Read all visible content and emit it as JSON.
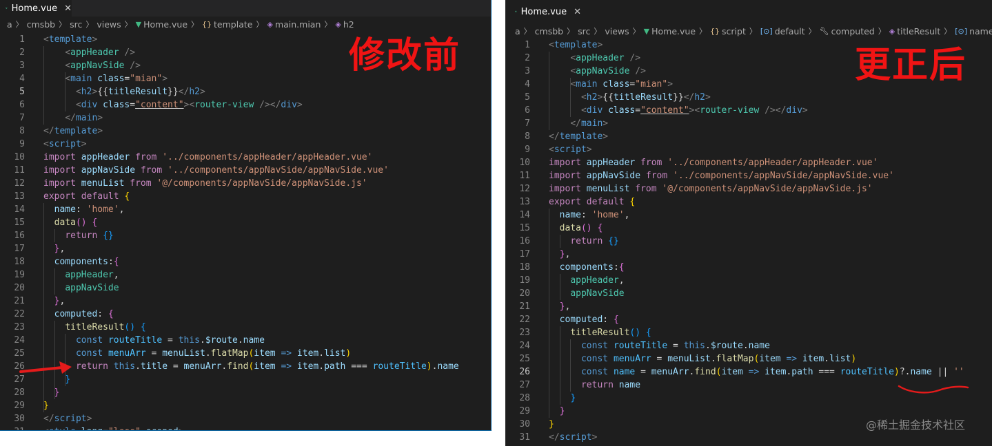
{
  "colors": {
    "editor_bg": "#1e1e1e",
    "annotation_red": "#f01414",
    "vue_green": "#41b883"
  },
  "left_editor": {
    "tab": {
      "label": "Home.vue",
      "icon": "vue-icon",
      "close": "✕"
    },
    "breadcrumb": [
      "a",
      "cmsbb",
      "src",
      "views",
      "Home.vue",
      "template",
      "main.mian",
      "h2"
    ],
    "annotation": "修改前"
  },
  "right_editor": {
    "tab": {
      "label": "Home.vue",
      "icon": "vue-icon",
      "close": "✕"
    },
    "breadcrumb": [
      "a",
      "cmsbb",
      "src",
      "views",
      "Home.vue",
      "script",
      "default",
      "computed",
      "titleResult",
      "name"
    ],
    "annotation": "更正后"
  },
  "watermark": "@稀土掘金技术社区",
  "code_before": [
    [
      [
        "t-br",
        "<"
      ],
      [
        "t-tag",
        "template"
      ],
      [
        "t-br",
        ">"
      ]
    ],
    [
      [
        "t-plain",
        "    "
      ],
      [
        "t-br",
        "<"
      ],
      [
        "t-cmp",
        "appHeader"
      ],
      [
        "t-plain",
        " "
      ],
      [
        "t-br",
        "/>"
      ]
    ],
    [
      [
        "t-plain",
        "    "
      ],
      [
        "t-br",
        "<"
      ],
      [
        "t-cmp",
        "appNavSide"
      ],
      [
        "t-plain",
        " "
      ],
      [
        "t-br",
        "/>"
      ]
    ],
    [
      [
        "t-plain",
        "    "
      ],
      [
        "t-br",
        "<"
      ],
      [
        "t-tag",
        "main"
      ],
      [
        "t-plain",
        " "
      ],
      [
        "t-attr",
        "class"
      ],
      [
        "t-plain",
        "="
      ],
      [
        "t-str",
        "\"mian\""
      ],
      [
        "t-br",
        ">"
      ]
    ],
    [
      [
        "t-plain",
        "      "
      ],
      [
        "t-br",
        "<"
      ],
      [
        "t-tag",
        "h2"
      ],
      [
        "t-br",
        ">"
      ],
      [
        "t-plain",
        "{{"
      ],
      [
        "t-var",
        "titleResult"
      ],
      [
        "t-plain",
        "}}"
      ],
      [
        "t-br",
        "</"
      ],
      [
        "t-tag",
        "h2"
      ],
      [
        "t-br",
        ">"
      ]
    ],
    [
      [
        "t-plain",
        "      "
      ],
      [
        "t-br",
        "<"
      ],
      [
        "t-tag",
        "div"
      ],
      [
        "t-plain",
        " "
      ],
      [
        "t-attr",
        "class"
      ],
      [
        "t-plain",
        "="
      ],
      [
        "t-str t-ul",
        "\"content\""
      ],
      [
        "t-br",
        ">"
      ],
      [
        "t-br",
        "<"
      ],
      [
        "t-cmp",
        "router-view"
      ],
      [
        "t-plain",
        " "
      ],
      [
        "t-br",
        "/>"
      ],
      [
        "t-br",
        "</"
      ],
      [
        "t-tag",
        "div"
      ],
      [
        "t-br",
        ">"
      ]
    ],
    [
      [
        "t-plain",
        "    "
      ],
      [
        "t-br",
        "</"
      ],
      [
        "t-tag",
        "main"
      ],
      [
        "t-br",
        ">"
      ]
    ],
    [
      [
        "t-br",
        "</"
      ],
      [
        "t-tag",
        "template"
      ],
      [
        "t-br",
        ">"
      ]
    ],
    [
      [
        "t-br",
        "<"
      ],
      [
        "t-tag",
        "script"
      ],
      [
        "t-br",
        ">"
      ]
    ],
    [
      [
        "t-kw",
        "import"
      ],
      [
        "t-plain",
        " "
      ],
      [
        "t-var",
        "appHeader"
      ],
      [
        "t-plain",
        " "
      ],
      [
        "t-kw",
        "from"
      ],
      [
        "t-plain",
        " "
      ],
      [
        "t-str",
        "'../components/appHeader/appHeader.vue'"
      ]
    ],
    [
      [
        "t-kw",
        "import"
      ],
      [
        "t-plain",
        " "
      ],
      [
        "t-var",
        "appNavSide"
      ],
      [
        "t-plain",
        " "
      ],
      [
        "t-kw",
        "from"
      ],
      [
        "t-plain",
        " "
      ],
      [
        "t-str",
        "'../components/appNavSide/appNavSide.vue'"
      ]
    ],
    [
      [
        "t-kw",
        "import"
      ],
      [
        "t-plain",
        " "
      ],
      [
        "t-var",
        "menuList"
      ],
      [
        "t-plain",
        " "
      ],
      [
        "t-kw",
        "from"
      ],
      [
        "t-plain",
        " "
      ],
      [
        "t-str",
        "'@/components/appNavSide/appNavSide.js'"
      ]
    ],
    [
      [
        "t-kw",
        "export"
      ],
      [
        "t-plain",
        " "
      ],
      [
        "t-kw",
        "default"
      ],
      [
        "t-plain",
        " "
      ],
      [
        "t-yel",
        "{"
      ]
    ],
    [
      [
        "t-plain",
        "  "
      ],
      [
        "t-var",
        "name"
      ],
      [
        "t-plain",
        ": "
      ],
      [
        "t-str",
        "'home'"
      ],
      [
        "t-plain",
        ","
      ]
    ],
    [
      [
        "t-plain",
        "  "
      ],
      [
        "t-fn",
        "data"
      ],
      [
        "t-pur",
        "()"
      ],
      [
        "t-plain",
        " "
      ],
      [
        "t-pur",
        "{"
      ]
    ],
    [
      [
        "t-plain",
        "    "
      ],
      [
        "t-kw",
        "return"
      ],
      [
        "t-plain",
        " "
      ],
      [
        "t-sky",
        "{}"
      ]
    ],
    [
      [
        "t-plain",
        "  "
      ],
      [
        "t-pur",
        "}"
      ],
      [
        "t-plain",
        ","
      ]
    ],
    [
      [
        "t-plain",
        "  "
      ],
      [
        "t-var",
        "components"
      ],
      [
        "t-plain",
        ":"
      ],
      [
        "t-pur",
        "{"
      ]
    ],
    [
      [
        "t-plain",
        "    "
      ],
      [
        "t-cmp",
        "appHeader"
      ],
      [
        "t-plain",
        ","
      ]
    ],
    [
      [
        "t-plain",
        "    "
      ],
      [
        "t-cmp",
        "appNavSide"
      ]
    ],
    [
      [
        "t-plain",
        "  "
      ],
      [
        "t-pur",
        "}"
      ],
      [
        "t-plain",
        ","
      ]
    ],
    [
      [
        "t-plain",
        "  "
      ],
      [
        "t-var",
        "computed"
      ],
      [
        "t-plain",
        ": "
      ],
      [
        "t-pur",
        "{"
      ]
    ],
    [
      [
        "t-plain",
        "    "
      ],
      [
        "t-fn",
        "titleResult"
      ],
      [
        "t-sky",
        "()"
      ],
      [
        "t-plain",
        " "
      ],
      [
        "t-sky",
        "{"
      ]
    ],
    [
      [
        "t-plain",
        "      "
      ],
      [
        "t-bl",
        "const"
      ],
      [
        "t-plain",
        " "
      ],
      [
        "t-cst",
        "routeTitle"
      ],
      [
        "t-plain",
        " = "
      ],
      [
        "t-bl",
        "this"
      ],
      [
        "t-plain",
        "."
      ],
      [
        "t-var",
        "$route"
      ],
      [
        "t-plain",
        "."
      ],
      [
        "t-var",
        "name"
      ]
    ],
    [
      [
        "t-plain",
        "      "
      ],
      [
        "t-bl",
        "const"
      ],
      [
        "t-plain",
        " "
      ],
      [
        "t-cst",
        "menuArr"
      ],
      [
        "t-plain",
        " = "
      ],
      [
        "t-var",
        "menuList"
      ],
      [
        "t-plain",
        "."
      ],
      [
        "t-fn",
        "flatMap"
      ],
      [
        "t-yel",
        "("
      ],
      [
        "t-var",
        "item"
      ],
      [
        "t-plain",
        " "
      ],
      [
        "t-bl",
        "=>"
      ],
      [
        "t-plain",
        " "
      ],
      [
        "t-var",
        "item"
      ],
      [
        "t-plain",
        "."
      ],
      [
        "t-var",
        "list"
      ],
      [
        "t-yel",
        ")"
      ]
    ],
    [
      [
        "t-plain",
        "      "
      ],
      [
        "t-kw",
        "return"
      ],
      [
        "t-plain",
        " "
      ],
      [
        "t-bl",
        "this"
      ],
      [
        "t-plain",
        "."
      ],
      [
        "t-var",
        "title"
      ],
      [
        "t-plain",
        " = "
      ],
      [
        "t-var",
        "menuArr"
      ],
      [
        "t-plain",
        "."
      ],
      [
        "t-fn",
        "find"
      ],
      [
        "t-yel",
        "("
      ],
      [
        "t-var",
        "item"
      ],
      [
        "t-plain",
        " "
      ],
      [
        "t-bl",
        "=>"
      ],
      [
        "t-plain",
        " "
      ],
      [
        "t-var",
        "item"
      ],
      [
        "t-plain",
        "."
      ],
      [
        "t-var",
        "path"
      ],
      [
        "t-plain",
        " === "
      ],
      [
        "t-cst",
        "routeTitle"
      ],
      [
        "t-yel",
        ")"
      ],
      [
        "t-plain",
        "."
      ],
      [
        "t-var",
        "name"
      ]
    ],
    [
      [
        "t-plain",
        "    "
      ],
      [
        "t-sky",
        "}"
      ]
    ],
    [
      [
        "t-plain",
        "  "
      ],
      [
        "t-pur",
        "}"
      ]
    ],
    [
      [
        "t-yel",
        "}"
      ]
    ],
    [
      [
        "t-br",
        "</"
      ],
      [
        "t-tag",
        "script"
      ],
      [
        "t-br",
        ">"
      ]
    ],
    [
      [
        "t-br",
        "<"
      ],
      [
        "t-tag",
        "style"
      ],
      [
        "t-plain",
        " "
      ],
      [
        "t-attr",
        "lang"
      ],
      [
        "t-plain",
        "="
      ],
      [
        "t-str",
        "\"less\""
      ],
      [
        "t-plain",
        " "
      ],
      [
        "t-attr",
        "scoped"
      ],
      [
        "t-br",
        ">"
      ]
    ]
  ],
  "code_after": [
    [
      [
        "t-br",
        "<"
      ],
      [
        "t-tag",
        "template"
      ],
      [
        "t-br",
        ">"
      ]
    ],
    [
      [
        "t-plain",
        "    "
      ],
      [
        "t-br",
        "<"
      ],
      [
        "t-cmp",
        "appHeader"
      ],
      [
        "t-plain",
        " "
      ],
      [
        "t-br",
        "/>"
      ]
    ],
    [
      [
        "t-plain",
        "    "
      ],
      [
        "t-br",
        "<"
      ],
      [
        "t-cmp",
        "appNavSide"
      ],
      [
        "t-plain",
        " "
      ],
      [
        "t-br",
        "/>"
      ]
    ],
    [
      [
        "t-plain",
        "    "
      ],
      [
        "t-br",
        "<"
      ],
      [
        "t-tag",
        "main"
      ],
      [
        "t-plain",
        " "
      ],
      [
        "t-attr",
        "class"
      ],
      [
        "t-plain",
        "="
      ],
      [
        "t-str",
        "\"mian\""
      ],
      [
        "t-br",
        ">"
      ]
    ],
    [
      [
        "t-plain",
        "      "
      ],
      [
        "t-br",
        "<"
      ],
      [
        "t-tag",
        "h2"
      ],
      [
        "t-br",
        ">"
      ],
      [
        "t-plain",
        "{{"
      ],
      [
        "t-var",
        "titleResult"
      ],
      [
        "t-plain",
        "}}"
      ],
      [
        "t-br",
        "</"
      ],
      [
        "t-tag",
        "h2"
      ],
      [
        "t-br",
        ">"
      ]
    ],
    [
      [
        "t-plain",
        "      "
      ],
      [
        "t-br",
        "<"
      ],
      [
        "t-tag",
        "div"
      ],
      [
        "t-plain",
        " "
      ],
      [
        "t-attr",
        "class"
      ],
      [
        "t-plain",
        "="
      ],
      [
        "t-str t-ul",
        "\"content\""
      ],
      [
        "t-br",
        ">"
      ],
      [
        "t-br",
        "<"
      ],
      [
        "t-cmp",
        "router-view"
      ],
      [
        "t-plain",
        " "
      ],
      [
        "t-br",
        "/>"
      ],
      [
        "t-br",
        "</"
      ],
      [
        "t-tag",
        "div"
      ],
      [
        "t-br",
        ">"
      ]
    ],
    [
      [
        "t-plain",
        "    "
      ],
      [
        "t-br",
        "</"
      ],
      [
        "t-tag",
        "main"
      ],
      [
        "t-br",
        ">"
      ]
    ],
    [
      [
        "t-br",
        "</"
      ],
      [
        "t-tag",
        "template"
      ],
      [
        "t-br",
        ">"
      ]
    ],
    [
      [
        "t-br",
        "<"
      ],
      [
        "t-tag",
        "script"
      ],
      [
        "t-br",
        ">"
      ]
    ],
    [
      [
        "t-kw",
        "import"
      ],
      [
        "t-plain",
        " "
      ],
      [
        "t-var",
        "appHeader"
      ],
      [
        "t-plain",
        " "
      ],
      [
        "t-kw",
        "from"
      ],
      [
        "t-plain",
        " "
      ],
      [
        "t-str",
        "'../components/appHeader/appHeader.vue'"
      ]
    ],
    [
      [
        "t-kw",
        "import"
      ],
      [
        "t-plain",
        " "
      ],
      [
        "t-var",
        "appNavSide"
      ],
      [
        "t-plain",
        " "
      ],
      [
        "t-kw",
        "from"
      ],
      [
        "t-plain",
        " "
      ],
      [
        "t-str",
        "'../components/appNavSide/appNavSide.vue'"
      ]
    ],
    [
      [
        "t-kw",
        "import"
      ],
      [
        "t-plain",
        " "
      ],
      [
        "t-var",
        "menuList"
      ],
      [
        "t-plain",
        " "
      ],
      [
        "t-kw",
        "from"
      ],
      [
        "t-plain",
        " "
      ],
      [
        "t-str",
        "'@/components/appNavSide/appNavSide.js'"
      ]
    ],
    [
      [
        "t-kw",
        "export"
      ],
      [
        "t-plain",
        " "
      ],
      [
        "t-kw",
        "default"
      ],
      [
        "t-plain",
        " "
      ],
      [
        "t-yel",
        "{"
      ]
    ],
    [
      [
        "t-plain",
        "  "
      ],
      [
        "t-var",
        "name"
      ],
      [
        "t-plain",
        ": "
      ],
      [
        "t-str",
        "'home'"
      ],
      [
        "t-plain",
        ","
      ]
    ],
    [
      [
        "t-plain",
        "  "
      ],
      [
        "t-fn",
        "data"
      ],
      [
        "t-pur",
        "()"
      ],
      [
        "t-plain",
        " "
      ],
      [
        "t-pur",
        "{"
      ]
    ],
    [
      [
        "t-plain",
        "    "
      ],
      [
        "t-kw",
        "return"
      ],
      [
        "t-plain",
        " "
      ],
      [
        "t-sky",
        "{}"
      ]
    ],
    [
      [
        "t-plain",
        "  "
      ],
      [
        "t-pur",
        "}"
      ],
      [
        "t-plain",
        ","
      ]
    ],
    [
      [
        "t-plain",
        "  "
      ],
      [
        "t-var",
        "components"
      ],
      [
        "t-plain",
        ":"
      ],
      [
        "t-pur",
        "{"
      ]
    ],
    [
      [
        "t-plain",
        "    "
      ],
      [
        "t-cmp",
        "appHeader"
      ],
      [
        "t-plain",
        ","
      ]
    ],
    [
      [
        "t-plain",
        "    "
      ],
      [
        "t-cmp",
        "appNavSide"
      ]
    ],
    [
      [
        "t-plain",
        "  "
      ],
      [
        "t-pur",
        "}"
      ],
      [
        "t-plain",
        ","
      ]
    ],
    [
      [
        "t-plain",
        "  "
      ],
      [
        "t-var",
        "computed"
      ],
      [
        "t-plain",
        ": "
      ],
      [
        "t-pur",
        "{"
      ]
    ],
    [
      [
        "t-plain",
        "    "
      ],
      [
        "t-fn",
        "titleResult"
      ],
      [
        "t-sky",
        "()"
      ],
      [
        "t-plain",
        " "
      ],
      [
        "t-sky",
        "{"
      ]
    ],
    [
      [
        "t-plain",
        "      "
      ],
      [
        "t-bl",
        "const"
      ],
      [
        "t-plain",
        " "
      ],
      [
        "t-cst",
        "routeTitle"
      ],
      [
        "t-plain",
        " = "
      ],
      [
        "t-bl",
        "this"
      ],
      [
        "t-plain",
        "."
      ],
      [
        "t-var",
        "$route"
      ],
      [
        "t-plain",
        "."
      ],
      [
        "t-var",
        "name"
      ]
    ],
    [
      [
        "t-plain",
        "      "
      ],
      [
        "t-bl",
        "const"
      ],
      [
        "t-plain",
        " "
      ],
      [
        "t-cst",
        "menuArr"
      ],
      [
        "t-plain",
        " = "
      ],
      [
        "t-var",
        "menuList"
      ],
      [
        "t-plain",
        "."
      ],
      [
        "t-fn",
        "flatMap"
      ],
      [
        "t-yel",
        "("
      ],
      [
        "t-var",
        "item"
      ],
      [
        "t-plain",
        " "
      ],
      [
        "t-bl",
        "=>"
      ],
      [
        "t-plain",
        " "
      ],
      [
        "t-var",
        "item"
      ],
      [
        "t-plain",
        "."
      ],
      [
        "t-var",
        "list"
      ],
      [
        "t-yel",
        ")"
      ]
    ],
    [
      [
        "t-plain",
        "      "
      ],
      [
        "t-bl",
        "const"
      ],
      [
        "t-plain",
        " "
      ],
      [
        "t-cst",
        "name"
      ],
      [
        "t-plain",
        " = "
      ],
      [
        "t-var",
        "menuArr"
      ],
      [
        "t-plain",
        "."
      ],
      [
        "t-fn",
        "find"
      ],
      [
        "t-yel",
        "("
      ],
      [
        "t-var",
        "item"
      ],
      [
        "t-plain",
        " "
      ],
      [
        "t-bl",
        "=>"
      ],
      [
        "t-plain",
        " "
      ],
      [
        "t-var",
        "item"
      ],
      [
        "t-plain",
        "."
      ],
      [
        "t-var",
        "path"
      ],
      [
        "t-plain",
        " === "
      ],
      [
        "t-cst",
        "routeTitle"
      ],
      [
        "t-yel",
        ")"
      ],
      [
        "t-plain",
        "?."
      ],
      [
        "t-var",
        "name"
      ],
      [
        "t-plain",
        " || "
      ],
      [
        "t-str",
        "''"
      ]
    ],
    [
      [
        "t-plain",
        "      "
      ],
      [
        "t-kw",
        "return"
      ],
      [
        "t-plain",
        " "
      ],
      [
        "t-var",
        "name"
      ]
    ],
    [
      [
        "t-plain",
        "    "
      ],
      [
        "t-sky",
        "}"
      ]
    ],
    [
      [
        "t-plain",
        "  "
      ],
      [
        "t-pur",
        "}"
      ]
    ],
    [
      [
        "t-yel",
        "}"
      ]
    ],
    [
      [
        "t-br",
        "</"
      ],
      [
        "t-tag",
        "script"
      ],
      [
        "t-br",
        ">"
      ]
    ]
  ],
  "active_line_before": 5,
  "active_line_after": 26
}
